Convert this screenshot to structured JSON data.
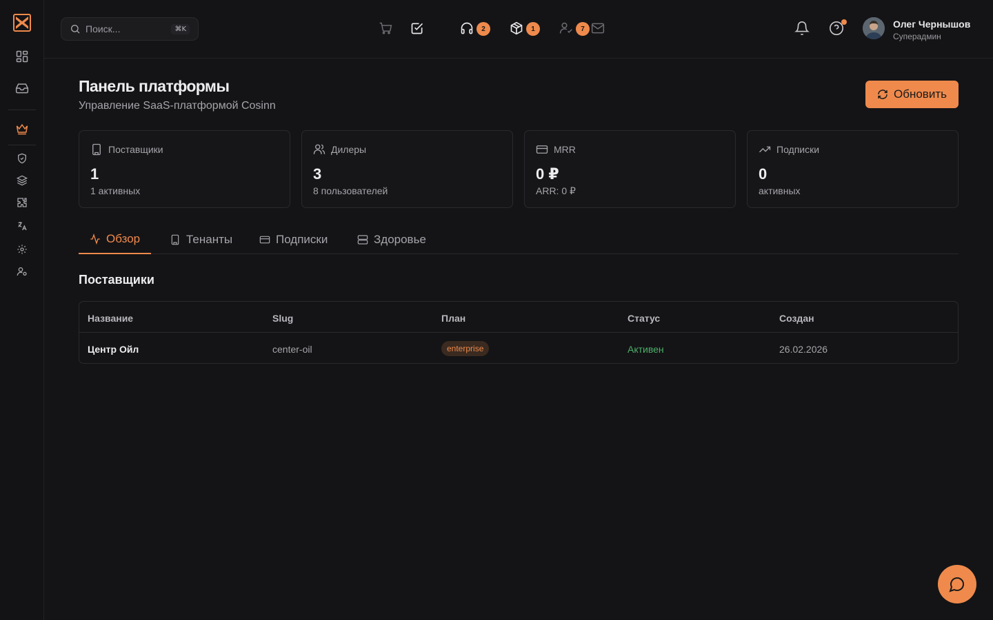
{
  "sidebar": {
    "items": [
      {
        "icon": "dashboard-icon"
      },
      {
        "icon": "inbox-icon"
      },
      {
        "icon": "crown-icon",
        "active": true
      },
      {
        "icon": "shield-check-icon"
      },
      {
        "icon": "layers-icon"
      },
      {
        "icon": "puzzle-icon"
      },
      {
        "icon": "translate-icon"
      },
      {
        "icon": "gear-icon"
      },
      {
        "icon": "user-settings-icon"
      }
    ]
  },
  "header": {
    "search_placeholder": "Поиск...",
    "search_shortcut": "⌘K",
    "icons": [
      {
        "icon": "cart-icon",
        "badge": ""
      },
      {
        "icon": "checkbox-icon",
        "badge": "2"
      },
      {
        "icon": "headset-icon",
        "badge": "1"
      },
      {
        "icon": "package-icon",
        "badge": "7"
      },
      {
        "icon": "user-check-icon",
        "badge": ""
      },
      {
        "icon": "mail-icon",
        "badge": ""
      }
    ],
    "user": {
      "name": "Олег Чернышов",
      "role": "Суперадмин"
    }
  },
  "page": {
    "title": "Панель платформы",
    "subtitle": "Управление SaaS-платформой Cosinn",
    "refresh_label": "Обновить"
  },
  "cards": [
    {
      "label": "Поставщики",
      "value": "1",
      "sub": "1 активных",
      "icon": "building-icon"
    },
    {
      "label": "Дилеры",
      "value": "3",
      "sub": "8 пользователей",
      "icon": "users-icon"
    },
    {
      "label": "MRR",
      "value": "0 ₽",
      "sub": "ARR: 0 ₽",
      "icon": "credit-card-icon"
    },
    {
      "label": "Подписки",
      "value": "0",
      "sub": "активных",
      "icon": "trending-up-icon"
    }
  ],
  "tabs": [
    {
      "label": "Обзор",
      "icon": "activity-icon",
      "active": true
    },
    {
      "label": "Тенанты",
      "icon": "building-icon"
    },
    {
      "label": "Подписки",
      "icon": "credit-card-icon"
    },
    {
      "label": "Здоровье",
      "icon": "server-icon"
    }
  ],
  "suppliers": {
    "title": "Поставщики",
    "columns": [
      "Название",
      "Slug",
      "План",
      "Статус",
      "Создан"
    ],
    "rows": [
      {
        "name": "Центр Ойл",
        "slug": "center-oil",
        "plan": "enterprise",
        "status": "Активен",
        "created": "26.02.2026"
      }
    ]
  },
  "colors": {
    "accent": "#ef8a4c",
    "success": "#4caf68",
    "background": "#141416"
  }
}
